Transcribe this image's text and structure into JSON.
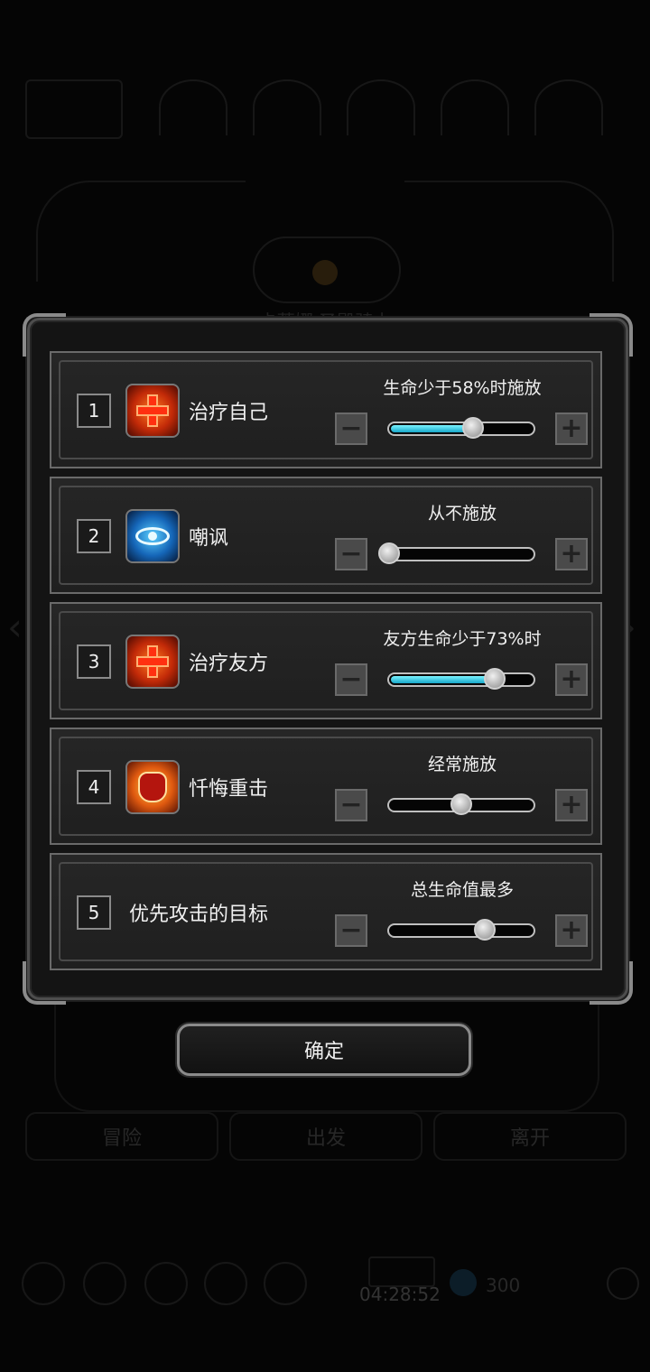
{
  "background": {
    "hero_name": "卡蒂娜 圣殿骑士",
    "buttons": [
      "冒险",
      "出发",
      "离开"
    ],
    "clock": "04:28:52",
    "gem_count": "300"
  },
  "dialog": {
    "rows": [
      {
        "number": "1",
        "icon": "heal-cross-icon",
        "name": "治疗自己",
        "condition": "生命少于58%时施放",
        "level": 0.58
      },
      {
        "number": "2",
        "icon": "taunt-eye-icon",
        "name": "嘲讽",
        "condition": "从不施放",
        "level": 0.0
      },
      {
        "number": "3",
        "icon": "heal-cross-icon",
        "name": "治疗友方",
        "condition": "友方生命少于73%时",
        "level": 0.73
      },
      {
        "number": "4",
        "icon": "fist-icon",
        "name": "忏悔重击",
        "condition": "经常施放",
        "level": 0.5
      },
      {
        "number": "5",
        "icon": "",
        "name": "优先攻击的目标",
        "condition": "总生命值最多",
        "level": 0.66
      }
    ],
    "minus_label": "−",
    "plus_label": "+",
    "confirm_label": "确定"
  },
  "colors": {
    "slider_fill": "#29c3e6",
    "panel": "#1f1f1f",
    "border": "#6a6a6a"
  }
}
